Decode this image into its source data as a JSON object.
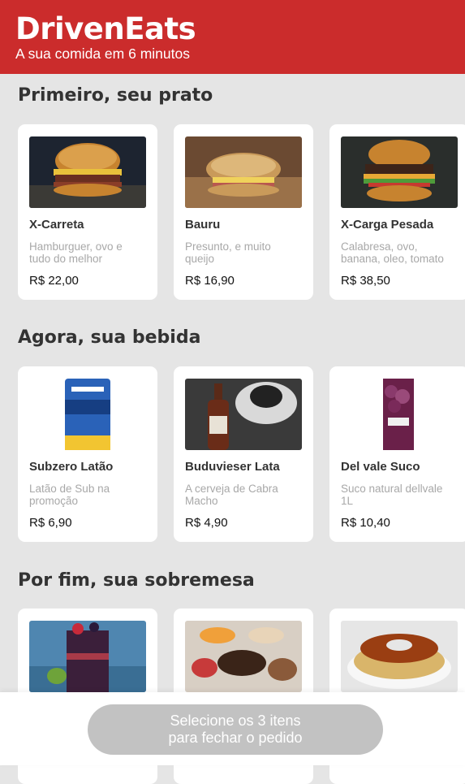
{
  "header": {
    "brand": "DrivenEats",
    "tagline": "A sua comida em 6 minutos"
  },
  "sections": [
    {
      "title": "Primeiro, seu prato",
      "items": [
        {
          "name": "X-Carreta",
          "description": "Hamburguer, ovo e tudo do melhor",
          "price": "R$ 22,00",
          "image": "burger-photo"
        },
        {
          "name": "Bauru",
          "description": "Presunto, e muito queijo",
          "price": "R$ 16,90",
          "image": "sandwich-photo"
        },
        {
          "name": "X-Carga Pesada",
          "description": "Calabresa, ovo, banana, oleo, tomato",
          "price": "R$ 38,50",
          "image": "burger-photo"
        }
      ]
    },
    {
      "title": "Agora, sua bebida",
      "items": [
        {
          "name": "Subzero Latão",
          "description": "Latão de Sub na promoção",
          "price": "R$ 6,90",
          "image": "beer-can-photo"
        },
        {
          "name": "Buduvieser Lata",
          "description": "A cerveja de Cabra Macho",
          "price": "R$ 4,90",
          "image": "beer-bottle-photo"
        },
        {
          "name": "Del vale Suco",
          "description": "Suco natural dellvale 1L",
          "price": "R$ 10,40",
          "image": "juice-box-photo"
        }
      ]
    },
    {
      "title": "Por fim, sua sobremesa",
      "items": [
        {
          "name": "",
          "description": "",
          "price": "",
          "image": "acai-cup-photo"
        },
        {
          "name": "",
          "description": "",
          "price": "",
          "image": "dessert-cups-photo"
        },
        {
          "name": "",
          "description": "",
          "price": "",
          "image": "pudding-photo"
        }
      ]
    }
  ],
  "footer": {
    "checkout_line1": "Selecione os 3 itens",
    "checkout_line2": "para fechar o pedido"
  }
}
